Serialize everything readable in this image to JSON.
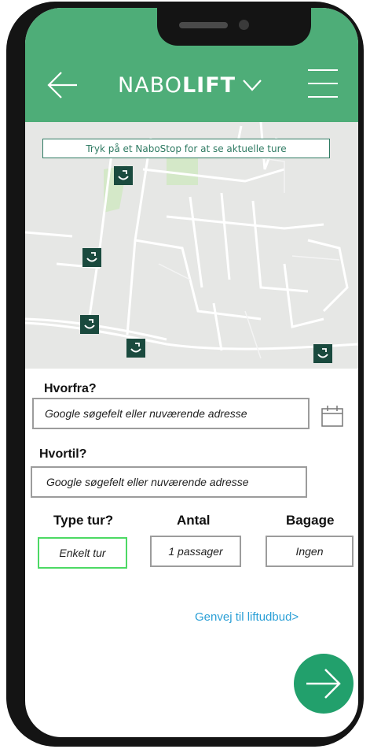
{
  "header": {
    "brand_light": "NABO",
    "brand_bold": "LIFT",
    "back_icon": "arrow-left-icon",
    "menu_icon": "hamburger-icon",
    "color": "#4ead78"
  },
  "map": {
    "banner": "Tryk på et NaboStop for at se aktuelle ture",
    "stop_icon": "smile-stop-icon",
    "stop_color": "#1a4a3e"
  },
  "form": {
    "from_label": "Hvorfra?",
    "from_placeholder": "Google søgefelt eller nuværende adresse",
    "to_label": "Hvortil?",
    "to_placeholder": "Google søgefelt eller nuværende adresse",
    "type_label": "Type tur?",
    "type_value": "Enkelt tur",
    "count_label": "Antal",
    "count_value": "1 passager",
    "luggage_label": "Bagage",
    "luggage_value": "Ingen",
    "selected_color": "#4cd964"
  },
  "shortcut_link": "Genvej til liftudbud>",
  "next_button": {
    "icon": "arrow-right-icon",
    "color": "#22a06c"
  }
}
